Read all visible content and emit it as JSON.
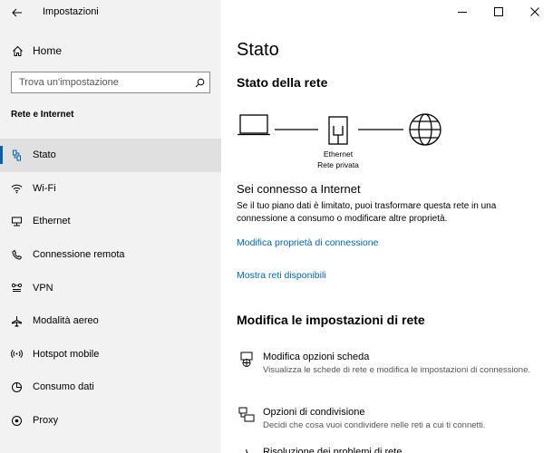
{
  "window": {
    "title": "Impostazioni",
    "minimize": "─",
    "maximize": "☐",
    "close": "✕"
  },
  "sidebar": {
    "home_label": "Home",
    "search_placeholder": "Trova un'impostazione",
    "section_label": "Rete e Internet",
    "items": [
      {
        "label": "Stato",
        "icon": "status-icon",
        "selected": true
      },
      {
        "label": "Wi-Fi",
        "icon": "wifi-icon",
        "selected": false
      },
      {
        "label": "Ethernet",
        "icon": "ethernet-icon",
        "selected": false
      },
      {
        "label": "Connessione remota",
        "icon": "dialup-icon",
        "selected": false
      },
      {
        "label": "VPN",
        "icon": "vpn-icon",
        "selected": false
      },
      {
        "label": "Modalità aereo",
        "icon": "airplane-icon",
        "selected": false
      },
      {
        "label": "Hotspot mobile",
        "icon": "hotspot-icon",
        "selected": false
      },
      {
        "label": "Consumo dati",
        "icon": "data-usage-icon",
        "selected": false
      },
      {
        "label": "Proxy",
        "icon": "proxy-icon",
        "selected": false
      }
    ]
  },
  "main": {
    "title": "Stato",
    "network_status_title": "Stato della rete",
    "diagram": {
      "adapter_name": "Ethernet",
      "network_type": "Rete privata"
    },
    "connected_title": "Sei connesso a Internet",
    "connected_desc": "Se il tuo piano dati è limitato, puoi trasformare questa rete in una connessione a consumo o modificare altre proprietà.",
    "link_properties": "Modifica proprietà di connessione",
    "link_networks": "Mostra reti disponibili",
    "section2_title": "Modifica le impostazioni di rete",
    "options": [
      {
        "title": "Modifica opzioni scheda",
        "desc": "Visualizza le schede di rete e modifica le impostazioni di connessione."
      },
      {
        "title": "Opzioni di condivisione",
        "desc": "Decidi che cosa vuoi condividere nelle reti a cui ti connetti."
      },
      {
        "title": "Risoluzione dei problemi di rete",
        "desc": ""
      }
    ]
  },
  "colors": {
    "accent": "#0063b1",
    "link": "#0067b8",
    "sidebar_bg": "#f2f2f2",
    "selected_bg": "#e0e0e0"
  }
}
